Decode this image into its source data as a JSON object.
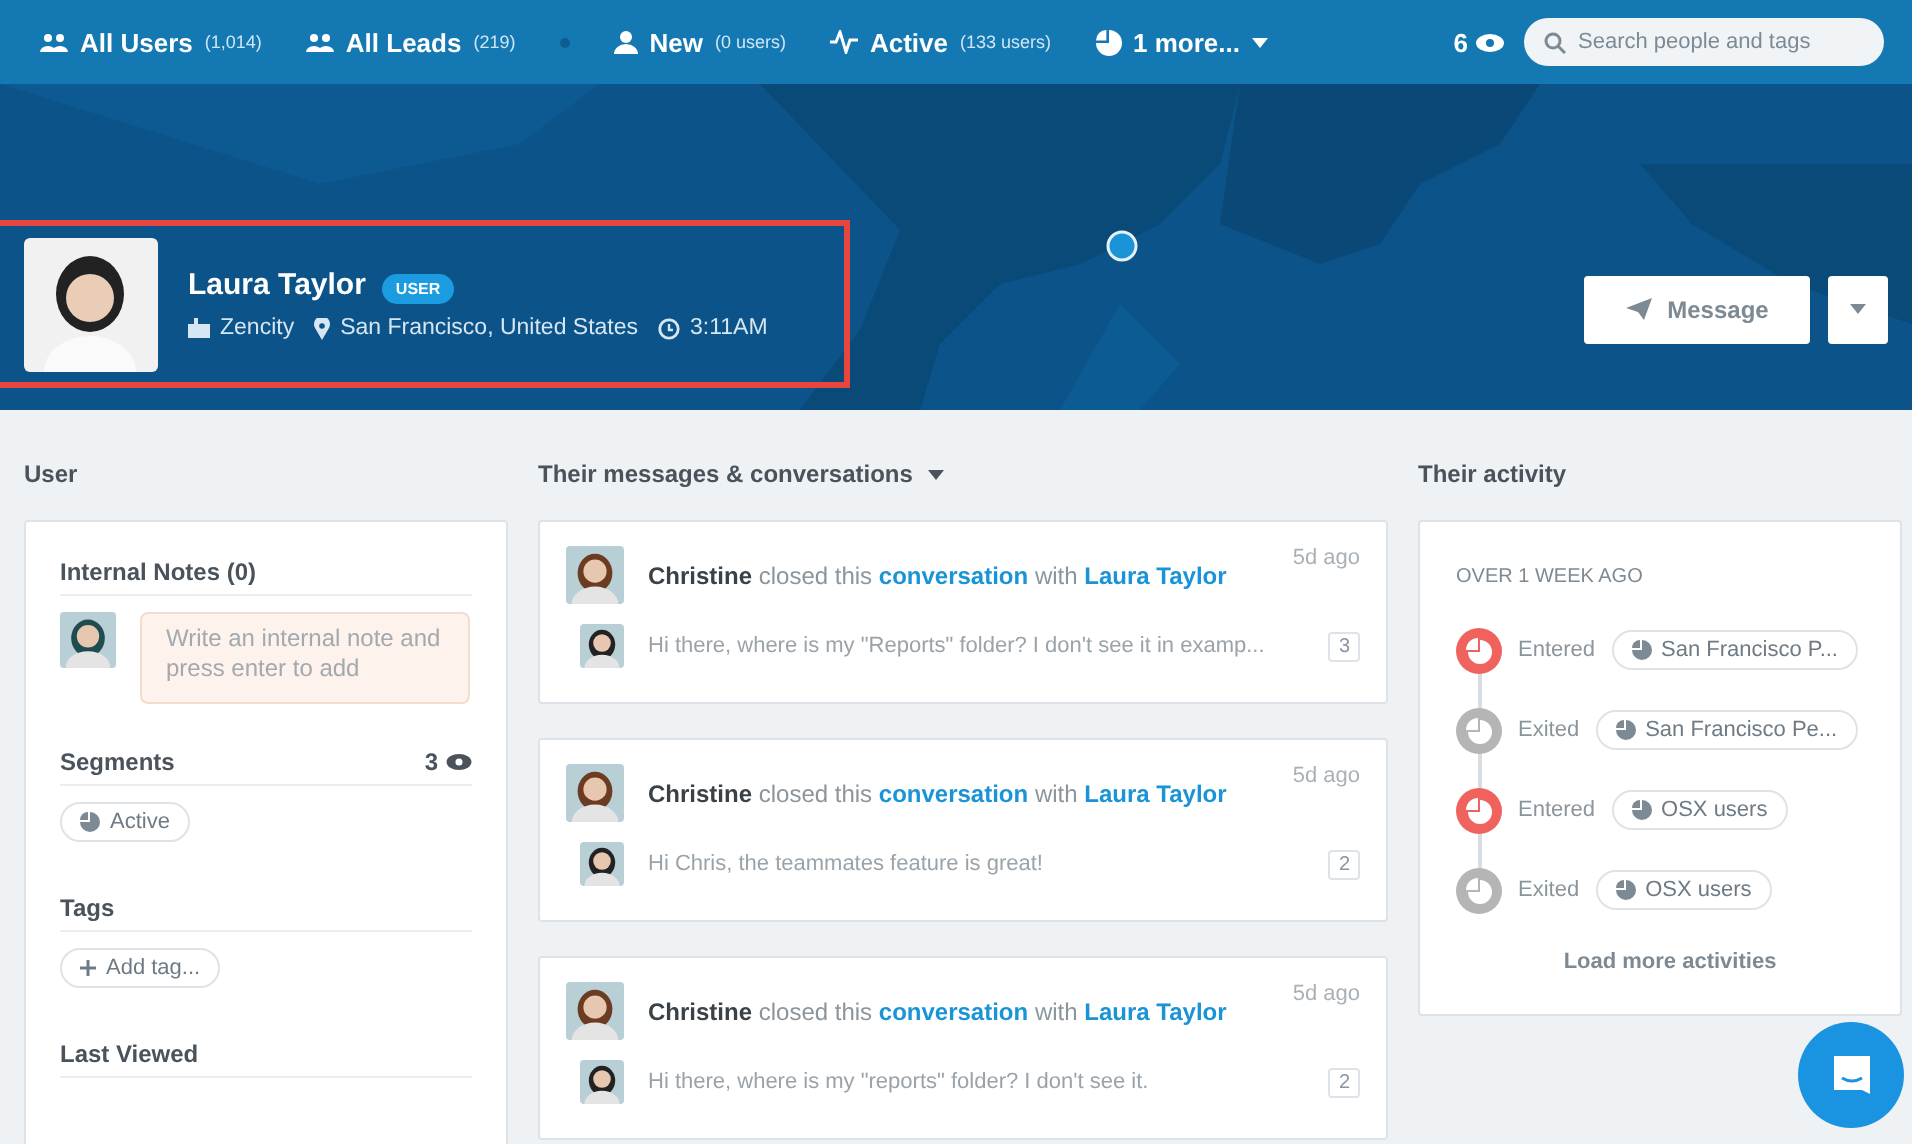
{
  "nav": {
    "items": [
      {
        "kind": "users",
        "label": "All Users",
        "count": "(1,014)"
      },
      {
        "kind": "users",
        "label": "All Leads",
        "count": "(219)"
      },
      {
        "kind": "user",
        "label": "New",
        "count": "(0 users)"
      },
      {
        "kind": "pulse",
        "label": "Active",
        "count": "(133 users)"
      },
      {
        "kind": "pie",
        "label": "1 more..."
      }
    ],
    "viewers": "6",
    "search": {
      "placeholder": "Search people and tags"
    }
  },
  "profile": {
    "name": "Laura Taylor",
    "badge": "USER",
    "company": "Zencity",
    "location": "San Francisco, United States",
    "time": "3:11AM",
    "highlighted": true,
    "message_button": "Message"
  },
  "user_panel": {
    "heading": "User",
    "notes_title": "Internal Notes (0)",
    "note": {
      "placeholder": "Write an internal note and press enter to add"
    },
    "segments_title": "Segments",
    "segments_count": "3",
    "segments": [
      "Active"
    ],
    "tags_title": "Tags",
    "add_tag": "Add tag...",
    "last_viewed_title": "Last Viewed"
  },
  "conversations": {
    "heading": "Their messages & conversations",
    "items": [
      {
        "author": "Christine",
        "verb": "closed this",
        "link": "conversation",
        "with": "with",
        "user": "Laura Taylor",
        "time": "5d ago",
        "preview": "Hi there, where is my \"Reports\" folder? I don't see it in examp...",
        "count": "3"
      },
      {
        "author": "Christine",
        "verb": "closed this",
        "link": "conversation",
        "with": "with",
        "user": "Laura Taylor",
        "time": "5d ago",
        "preview": "Hi Chris, the teammates feature is great!",
        "count": "2"
      },
      {
        "author": "Christine",
        "verb": "closed this",
        "link": "conversation",
        "with": "with",
        "user": "Laura Taylor",
        "time": "5d ago",
        "preview": "Hi there, where is my \"reports\" folder? I don't see it.",
        "count": "2"
      }
    ]
  },
  "activity": {
    "heading": "Their activity",
    "period": "OVER 1 WEEK AGO",
    "items": [
      {
        "kind": "entered",
        "action": "Entered",
        "segment": "San Francisco P..."
      },
      {
        "kind": "exited",
        "action": "Exited",
        "segment": "San Francisco Pe..."
      },
      {
        "kind": "entered",
        "action": "Entered",
        "segment": "OSX users"
      },
      {
        "kind": "exited",
        "action": "Exited",
        "segment": "OSX users"
      }
    ],
    "load_more": "Load more activities"
  }
}
